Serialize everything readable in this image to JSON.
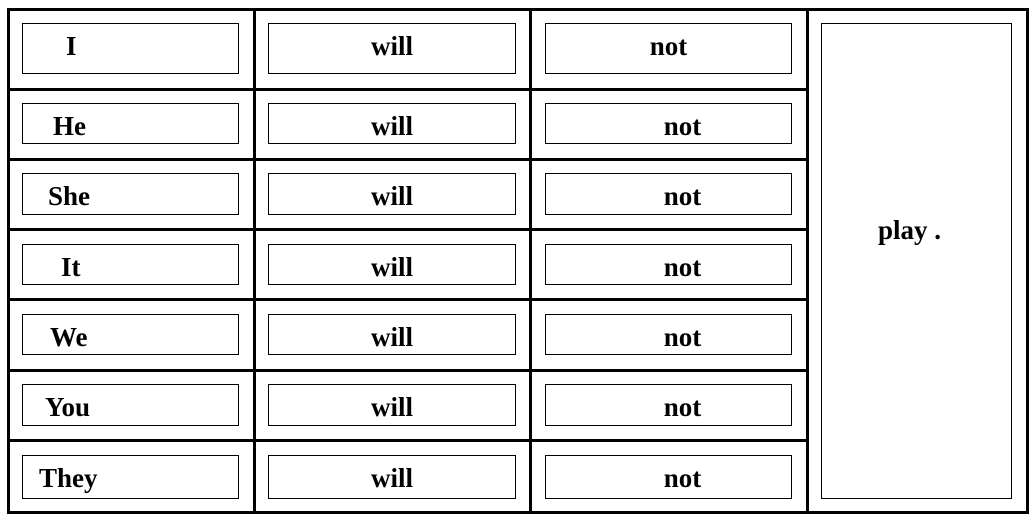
{
  "table": {
    "rows": [
      {
        "subject": "I",
        "auxiliary": "will",
        "negation": "not"
      },
      {
        "subject": "He",
        "auxiliary": "will",
        "negation": "not"
      },
      {
        "subject": "She",
        "auxiliary": "will",
        "negation": "not"
      },
      {
        "subject": "It",
        "auxiliary": "will",
        "negation": "not"
      },
      {
        "subject": "We",
        "auxiliary": "will",
        "negation": "not"
      },
      {
        "subject": "You",
        "auxiliary": "will",
        "negation": "not"
      },
      {
        "subject": "They",
        "auxiliary": "will",
        "negation": "not"
      }
    ],
    "verb": "play ."
  }
}
